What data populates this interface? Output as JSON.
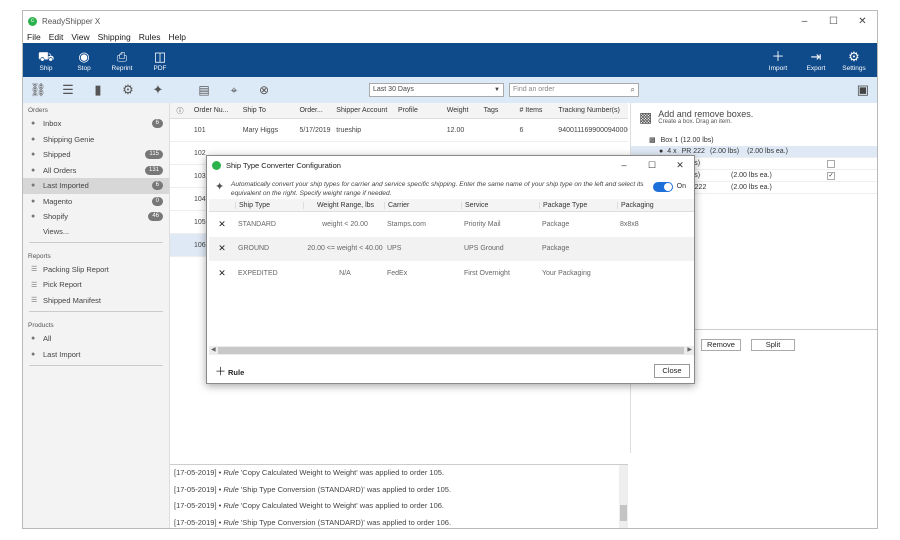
{
  "app": {
    "title": "ReadyShipper X"
  },
  "menu": [
    "File",
    "Edit",
    "View",
    "Shipping",
    "Rules",
    "Help"
  ],
  "ribbon": {
    "left": [
      {
        "label": "Ship",
        "icon": "truck-icon"
      },
      {
        "label": "Stop",
        "icon": "stop-icon"
      },
      {
        "label": "Reprint",
        "icon": "printer-icon"
      },
      {
        "label": "PDF",
        "icon": "pdf-icon"
      }
    ],
    "right": [
      {
        "label": "Import",
        "icon": "plus-icon"
      },
      {
        "label": "Export",
        "icon": "export-icon"
      },
      {
        "label": "Settings",
        "icon": "gear-icon"
      }
    ]
  },
  "toolbar": {
    "date_filter": "Last 30 Days",
    "search_placeholder": "Find an order"
  },
  "sidebar": {
    "orders_header": "Orders",
    "orders": [
      {
        "label": "Inbox",
        "badge": "6"
      },
      {
        "label": "Shipping Genie",
        "badge": ""
      },
      {
        "label": "Shipped",
        "badge": "115"
      },
      {
        "label": "All Orders",
        "badge": "131"
      },
      {
        "label": "Last Imported",
        "badge": "6"
      },
      {
        "label": "Magento",
        "badge": "0"
      },
      {
        "label": "Shopify",
        "badge": "46"
      }
    ],
    "views_label": "Views...",
    "reports_header": "Reports",
    "reports": [
      "Packing Slip Report",
      "Pick Report",
      "Shipped Manifest"
    ],
    "products_header": "Products",
    "products": [
      "All",
      "Last Import"
    ]
  },
  "grid": {
    "columns": [
      "Order Nu...",
      "Ship To",
      "Order...",
      "Shipper Account",
      "Profile",
      "Weight",
      "Tags",
      "# Items",
      "Tracking Number(s)"
    ],
    "rows": [
      [
        "101",
        "Mary Higgs",
        "5/17/2019",
        "trueship",
        "",
        "12.00",
        "",
        "6",
        "9400111699000940000"
      ],
      [
        "102",
        "",
        "",
        "",
        "",
        "",
        "",
        "",
        ""
      ],
      [
        "103",
        "",
        "",
        "",
        "",
        "",
        "",
        "",
        ""
      ],
      [
        "104",
        "",
        "",
        "",
        "",
        "",
        "",
        "",
        ""
      ],
      [
        "105",
        "",
        "",
        "",
        "",
        "",
        "",
        "",
        ""
      ],
      [
        "106",
        "",
        "",
        "",
        "",
        "",
        "",
        "",
        ""
      ]
    ]
  },
  "right_panel": {
    "title": "Add and remove boxes.",
    "subtitle": "Create a box. Drag an item.",
    "box": "Box 1 (12.00 lbs)",
    "items": [
      {
        "qty": "4 x",
        "name": "PR 222",
        "weight": "(2.00 lbs)",
        "each": "(2.00 lbs ea.)",
        "checked": false
      },
      {
        "qty": "",
        "name": "",
        "weight": "0 lbs)",
        "each": "",
        "checked": false
      },
      {
        "qty": "",
        "name": "",
        "weight": "0 lbs)",
        "each": "(2.00 lbs ea.)",
        "checked": true
      },
      {
        "qty": "",
        "name": "PR 222",
        "weight": "",
        "each": "(2.00 lbs ea.)",
        "checked": false
      }
    ],
    "remove_label": "Remove",
    "split_label": "Split"
  },
  "log": [
    {
      "date": "[17-05-2019]",
      "rule": "Rule",
      "text": "'Copy Calculated Weight to Weight' was applied to order 105."
    },
    {
      "date": "[17-05-2019]",
      "rule": "Rule",
      "text": "'Ship Type Conversion (STANDARD)' was applied to order 105."
    },
    {
      "date": "[17-05-2019]",
      "rule": "Rule",
      "text": "'Copy Calculated Weight to Weight' was applied to order 106."
    },
    {
      "date": "[17-05-2019]",
      "rule": "Rule",
      "text": "'Ship Type Conversion (STANDARD)' was applied to order 106."
    }
  ],
  "dialog": {
    "title": "Ship Type Converter Configuration",
    "description": "Automatically convert your ship types for carrier and service specific shipping. Enter the same name of your ship type on the left and select its equivalent on the right. Specify weight range if needed.",
    "toggle_label": "On",
    "columns": [
      "Ship Type",
      "Weight Range, lbs",
      "Carrier",
      "Service",
      "Package Type",
      "Packaging"
    ],
    "rows": [
      [
        "STANDARD",
        "weight < 20.00",
        "Stamps.com",
        "Priority Mail",
        "Package",
        "8x8x8"
      ],
      [
        "GROUND",
        "20.00 <= weight < 40.00",
        "UPS",
        "UPS Ground",
        "Package",
        ""
      ],
      [
        "EXPEDITED",
        "N/A",
        "FedEx",
        "First Overnight",
        "Your Packaging",
        ""
      ]
    ],
    "add_rule": "Rule",
    "close_label": "Close"
  },
  "colors": {
    "ribbon": "#0f4a8a",
    "toolbar": "#dce9f6",
    "toggle": "#1e6fd9",
    "logo": "#2bb24c"
  }
}
